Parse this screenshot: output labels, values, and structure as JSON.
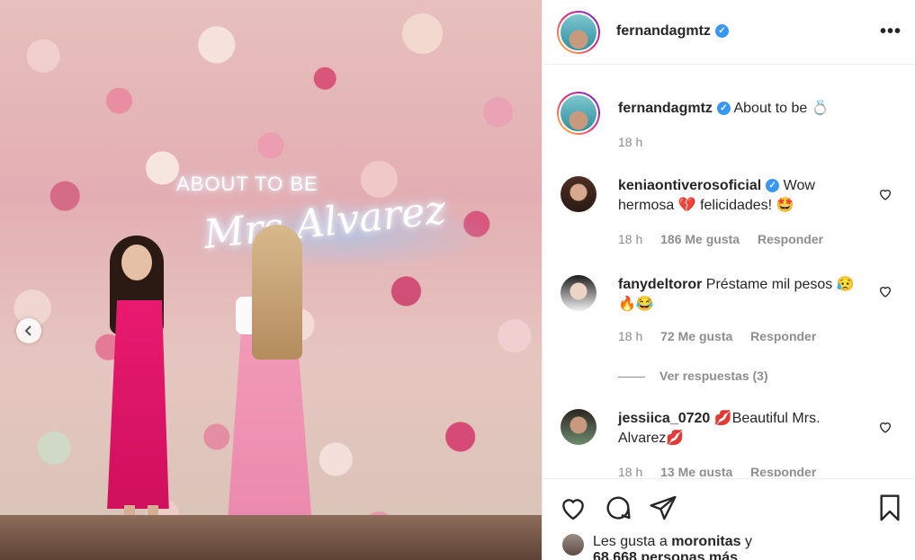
{
  "photo": {
    "neon_line1": "ABOUT TO BE",
    "neon_line2": "Mrs Alvarez"
  },
  "post": {
    "username": "fernandagmtz",
    "verified": true,
    "caption_username": "fernandagmtz",
    "caption_text": "About to be 💍",
    "caption_time": "18 h"
  },
  "comments": [
    {
      "username": "keniaontiverosoficial",
      "verified": true,
      "text": "Wow hermosa 💔 felicidades! 🤩",
      "time": "18 h",
      "likes": "186 Me gusta",
      "reply": "Responder"
    },
    {
      "username": "fanydeltoror",
      "verified": false,
      "text": "Préstame mil pesos 😥🔥😂",
      "time": "18 h",
      "likes": "72 Me gusta",
      "reply": "Responder",
      "view_replies": "Ver respuestas (3)"
    },
    {
      "username": "jessiica_0720",
      "verified": false,
      "text": "💋Beautiful Mrs. Alvarez💋",
      "time": "18 h",
      "likes": "13 Me gusta",
      "reply": "Responder"
    }
  ],
  "likes": {
    "prefix": "Les gusta a",
    "user": "moronitas",
    "suffix": "y",
    "others": "68.668 personas más"
  },
  "icons": [
    "more-options-icon",
    "heart-icon",
    "comment-icon",
    "share-icon",
    "bookmark-icon",
    "chevron-left-icon",
    "verified-badge-icon"
  ],
  "colors": {
    "verified": "#3897f0",
    "muted": "#8e8e8e",
    "text": "#262626"
  }
}
